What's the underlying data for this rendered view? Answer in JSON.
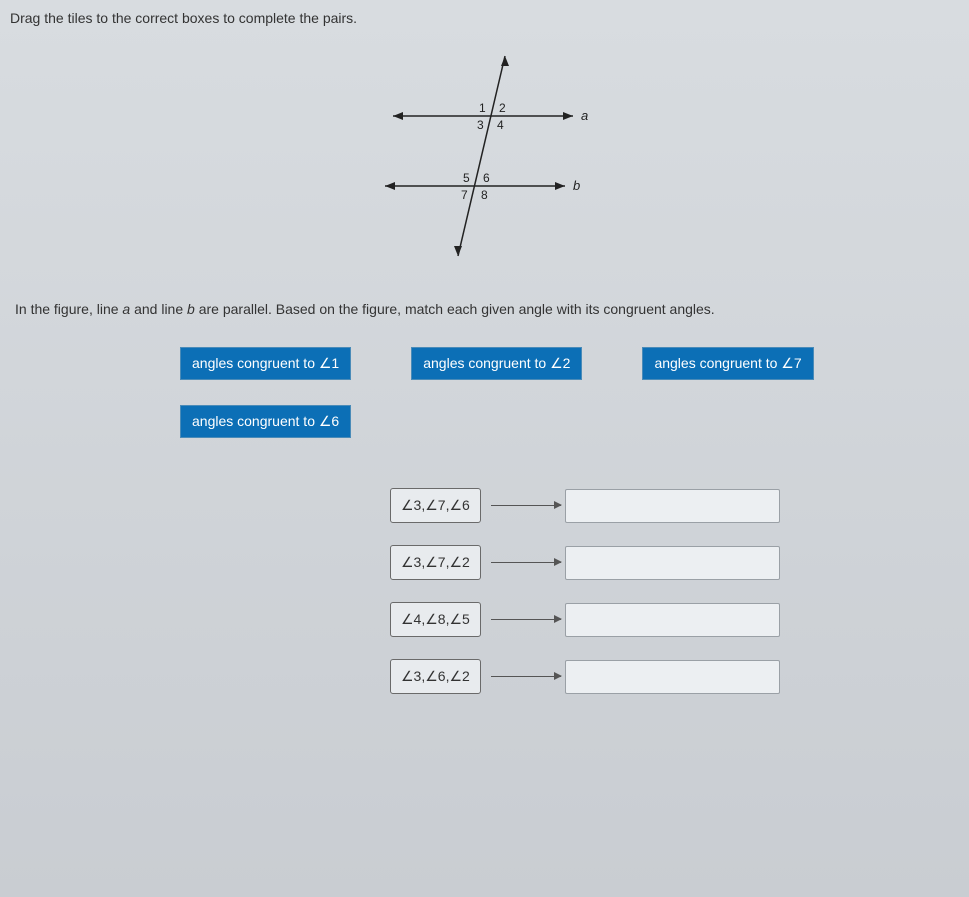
{
  "instruction": "Drag the tiles to the correct boxes to complete the pairs.",
  "figure": {
    "angles_top": [
      "1",
      "2",
      "3",
      "4"
    ],
    "angles_bottom": [
      "5",
      "6",
      "7",
      "8"
    ],
    "line_a_label": "a",
    "line_b_label": "b"
  },
  "post_figure_parts": {
    "p1": "In the figure, line ",
    "a": "a",
    "p2": " and line ",
    "b": "b",
    "p3": " are parallel. Based on the figure, match each given angle with its congruent angles."
  },
  "tiles": [
    "angles congruent to ∠1",
    "angles congruent to ∠2",
    "angles congruent to ∠7",
    "angles congruent to ∠6"
  ],
  "pairs": [
    "∠3,∠7,∠6",
    "∠3,∠7,∠2",
    "∠4,∠8,∠5",
    "∠3,∠6,∠2"
  ]
}
